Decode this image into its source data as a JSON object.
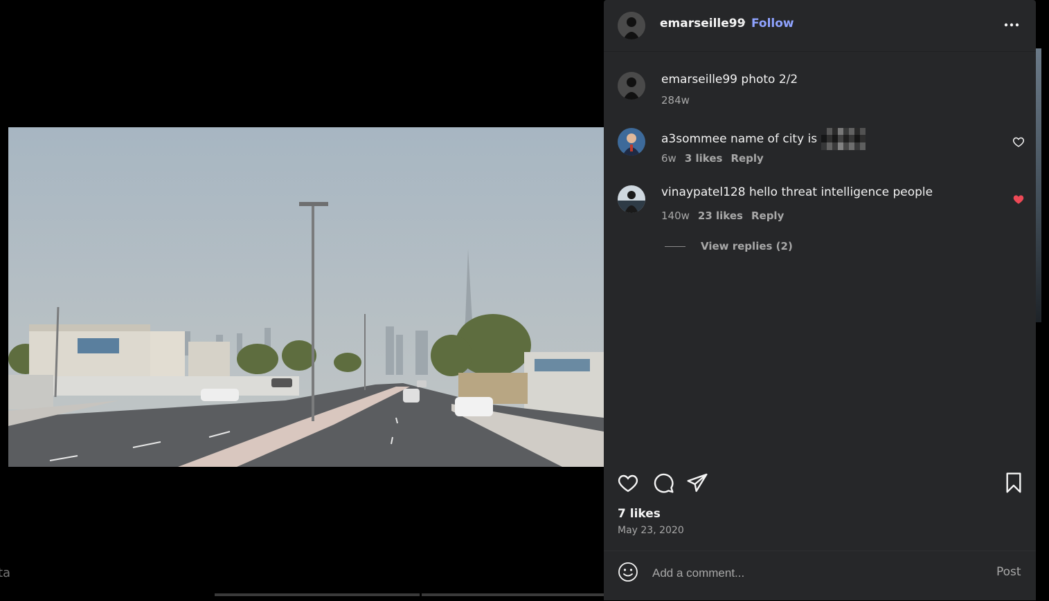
{
  "post": {
    "author": "emarseille99",
    "separator": "•",
    "follow_label": "Follow",
    "more_icon": "more-horizontal-icon",
    "caption": {
      "username": "emarseille99",
      "text": "photo 2/2",
      "time": "284w"
    },
    "comments": [
      {
        "username": "a3sommee",
        "text": "name of city is",
        "redacted": true,
        "time": "6w",
        "likes": "3 likes",
        "reply_label": "Reply",
        "liked": false
      },
      {
        "username": "vinaypatel128",
        "text": "hello threat intelligence people",
        "redacted": false,
        "time": "140w",
        "likes": "23 likes",
        "reply_label": "Reply",
        "liked": true
      }
    ],
    "view_replies_label": "View replies (2)",
    "likes_count": "7 likes",
    "date": "May 23, 2020",
    "comment_input": {
      "placeholder": "Add a comment...",
      "post_label": "Post"
    },
    "icons": [
      "heart-icon",
      "comment-icon",
      "share-icon",
      "bookmark-icon",
      "emoji-icon"
    ],
    "colors": {
      "panel_bg": "#262729",
      "follow": "#8fa3ff",
      "liked_heart": "#ed4956",
      "muted": "#a8a8a8"
    }
  },
  "background": {
    "fragment_text": "ta"
  }
}
